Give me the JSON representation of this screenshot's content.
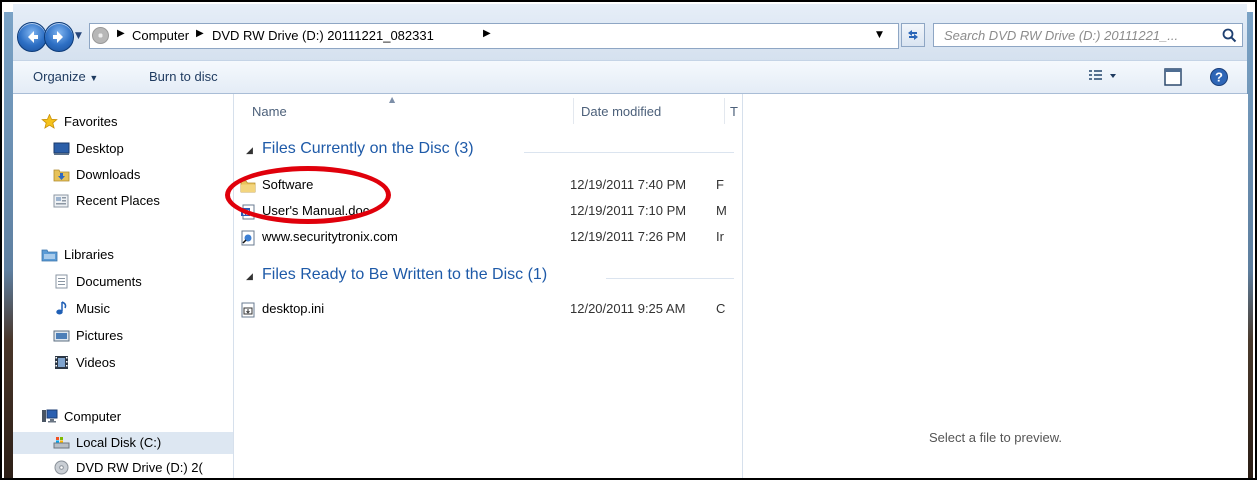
{
  "address": {
    "crumbs": [
      "Computer",
      "DVD RW Drive (D:) 20111221_082331"
    ],
    "search_placeholder": "Search DVD RW Drive (D:) 20111221_..."
  },
  "toolbar": {
    "organize_label": "Organize",
    "burn_label": "Burn to disc"
  },
  "navpane": {
    "favorites": {
      "label": "Favorites",
      "icon": "star-icon"
    },
    "favorites_items": [
      {
        "label": "Desktop",
        "icon": "desktop-icon"
      },
      {
        "label": "Downloads",
        "icon": "downloads-icon"
      },
      {
        "label": "Recent Places",
        "icon": "recent-places-icon"
      }
    ],
    "libraries": {
      "label": "Libraries",
      "icon": "libraries-icon"
    },
    "libraries_items": [
      {
        "label": "Documents",
        "icon": "documents-icon"
      },
      {
        "label": "Music",
        "icon": "music-icon"
      },
      {
        "label": "Pictures",
        "icon": "pictures-icon"
      },
      {
        "label": "Videos",
        "icon": "videos-icon"
      }
    ],
    "computer": {
      "label": "Computer",
      "icon": "computer-icon"
    },
    "computer_items": [
      {
        "label": "Local Disk (C:)",
        "icon": "local-disk-icon"
      },
      {
        "label": "DVD RW Drive (D:) 2(",
        "icon": "dvd-drive-icon",
        "selected": true
      }
    ]
  },
  "filelist": {
    "columns": [
      "Name",
      "Date modified",
      "T"
    ],
    "groups": [
      {
        "label": "Files Currently on the Disc (3)",
        "files": [
          {
            "name": "Software",
            "date": "12/19/2011 7:40 PM",
            "type": "F",
            "icon": "folder-icon"
          },
          {
            "name": "User's Manual.doc",
            "date": "12/19/2011 7:10 PM",
            "type": "M",
            "icon": "word-doc-icon"
          },
          {
            "name": "www.securitytronix.com",
            "date": "12/19/2011 7:26 PM",
            "type": "Ir",
            "icon": "internet-shortcut-icon"
          }
        ]
      },
      {
        "label": "Files Ready to Be Written to the Disc (1)",
        "files": [
          {
            "name": "desktop.ini",
            "date": "12/20/2011 9:25 AM",
            "type": "C",
            "icon": "ini-file-icon"
          }
        ]
      }
    ]
  },
  "preview": {
    "text": "Select a file to preview."
  },
  "annotation": {
    "color": "#e0000b"
  }
}
